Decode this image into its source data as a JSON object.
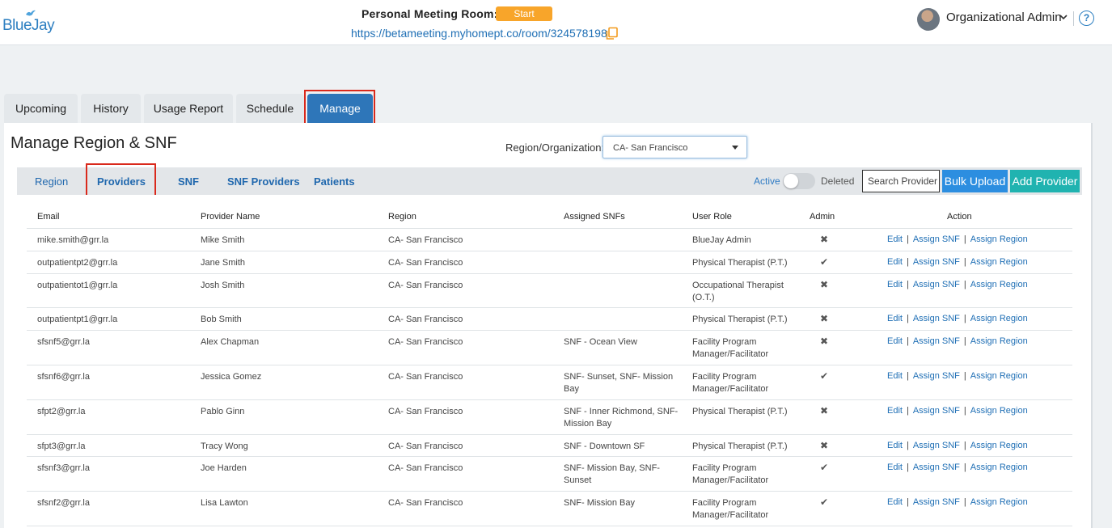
{
  "header": {
    "logo_text": "BlueJay",
    "pmr_label": "Personal Meeting Room:",
    "start_label": "Start",
    "room_url": "https://betameeting.myhomept.co/room/324578198",
    "user_name": "Organizational Admin",
    "help_label": "?"
  },
  "main_tabs": [
    {
      "label": "Upcoming"
    },
    {
      "label": "History"
    },
    {
      "label": "Usage Report"
    },
    {
      "label": "Schedule"
    },
    {
      "label": "Manage"
    }
  ],
  "page_title": "Manage Region & SNF",
  "region_filter": {
    "label": "Region/Organization:",
    "selected": "CA- San Francisco"
  },
  "sub_tabs": [
    {
      "label": "Region"
    },
    {
      "label": "Providers"
    },
    {
      "label": "SNF"
    },
    {
      "label": "SNF Providers"
    },
    {
      "label": "Patients"
    }
  ],
  "toolbar": {
    "active_label": "Active",
    "deleted_label": "Deleted",
    "search_placeholder": "Search Provider",
    "bulk_upload_label": "Bulk Upload",
    "add_provider_label": "Add Provider"
  },
  "table": {
    "columns": [
      "Email",
      "Provider Name",
      "Region",
      "Assigned SNFs",
      "User Role",
      "Admin",
      "Action"
    ],
    "actions": {
      "edit": "Edit",
      "assign_snf": "Assign SNF",
      "assign_region": "Assign Region",
      "separator": "|"
    },
    "admin_marks": {
      "yes": "✔",
      "no": "✖"
    },
    "rows": [
      {
        "email": "mike.smith@grr.la",
        "name": "Mike Smith",
        "region": "CA- San Francisco",
        "snfs": "",
        "role": "BlueJay Admin",
        "admin": false
      },
      {
        "email": "outpatientpt2@grr.la",
        "name": "Jane Smith",
        "region": "CA- San Francisco",
        "snfs": "",
        "role": "Physical Therapist (P.T.)",
        "admin": true
      },
      {
        "email": "outpatientot1@grr.la",
        "name": "Josh Smith",
        "region": "CA- San Francisco",
        "snfs": "",
        "role": "Occupational Therapist (O.T.)",
        "admin": false
      },
      {
        "email": "outpatientpt1@grr.la",
        "name": "Bob Smith",
        "region": "CA- San Francisco",
        "snfs": "",
        "role": "Physical Therapist (P.T.)",
        "admin": false
      },
      {
        "email": "sfsnf5@grr.la",
        "name": "Alex Chapman",
        "region": "CA- San Francisco",
        "snfs": "SNF - Ocean View",
        "role": "Facility Program Manager/Facilitator",
        "admin": false
      },
      {
        "email": "sfsnf6@grr.la",
        "name": "Jessica Gomez",
        "region": "CA- San Francisco",
        "snfs": "SNF- Sunset, SNF- Mission Bay",
        "role": "Facility Program Manager/Facilitator",
        "admin": true
      },
      {
        "email": "sfpt2@grr.la",
        "name": "Pablo Ginn",
        "region": "CA- San Francisco",
        "snfs": "SNF - Inner Richmond, SNF- Mission Bay",
        "role": "Physical Therapist (P.T.)",
        "admin": false
      },
      {
        "email": "sfpt3@grr.la",
        "name": "Tracy Wong",
        "region": "CA- San Francisco",
        "snfs": "SNF - Downtown SF",
        "role": "Physical Therapist (P.T.)",
        "admin": false
      },
      {
        "email": "sfsnf3@grr.la",
        "name": "Joe Harden",
        "region": "CA- San Francisco",
        "snfs": "SNF- Mission Bay, SNF- Sunset",
        "role": "Facility Program Manager/Facilitator",
        "admin": true
      },
      {
        "email": "sfsnf2@grr.la",
        "name": "Lisa Lawton",
        "region": "CA- San Francisco",
        "snfs": "SNF- Mission Bay",
        "role": "Facility Program Manager/Facilitator",
        "admin": true
      }
    ]
  }
}
